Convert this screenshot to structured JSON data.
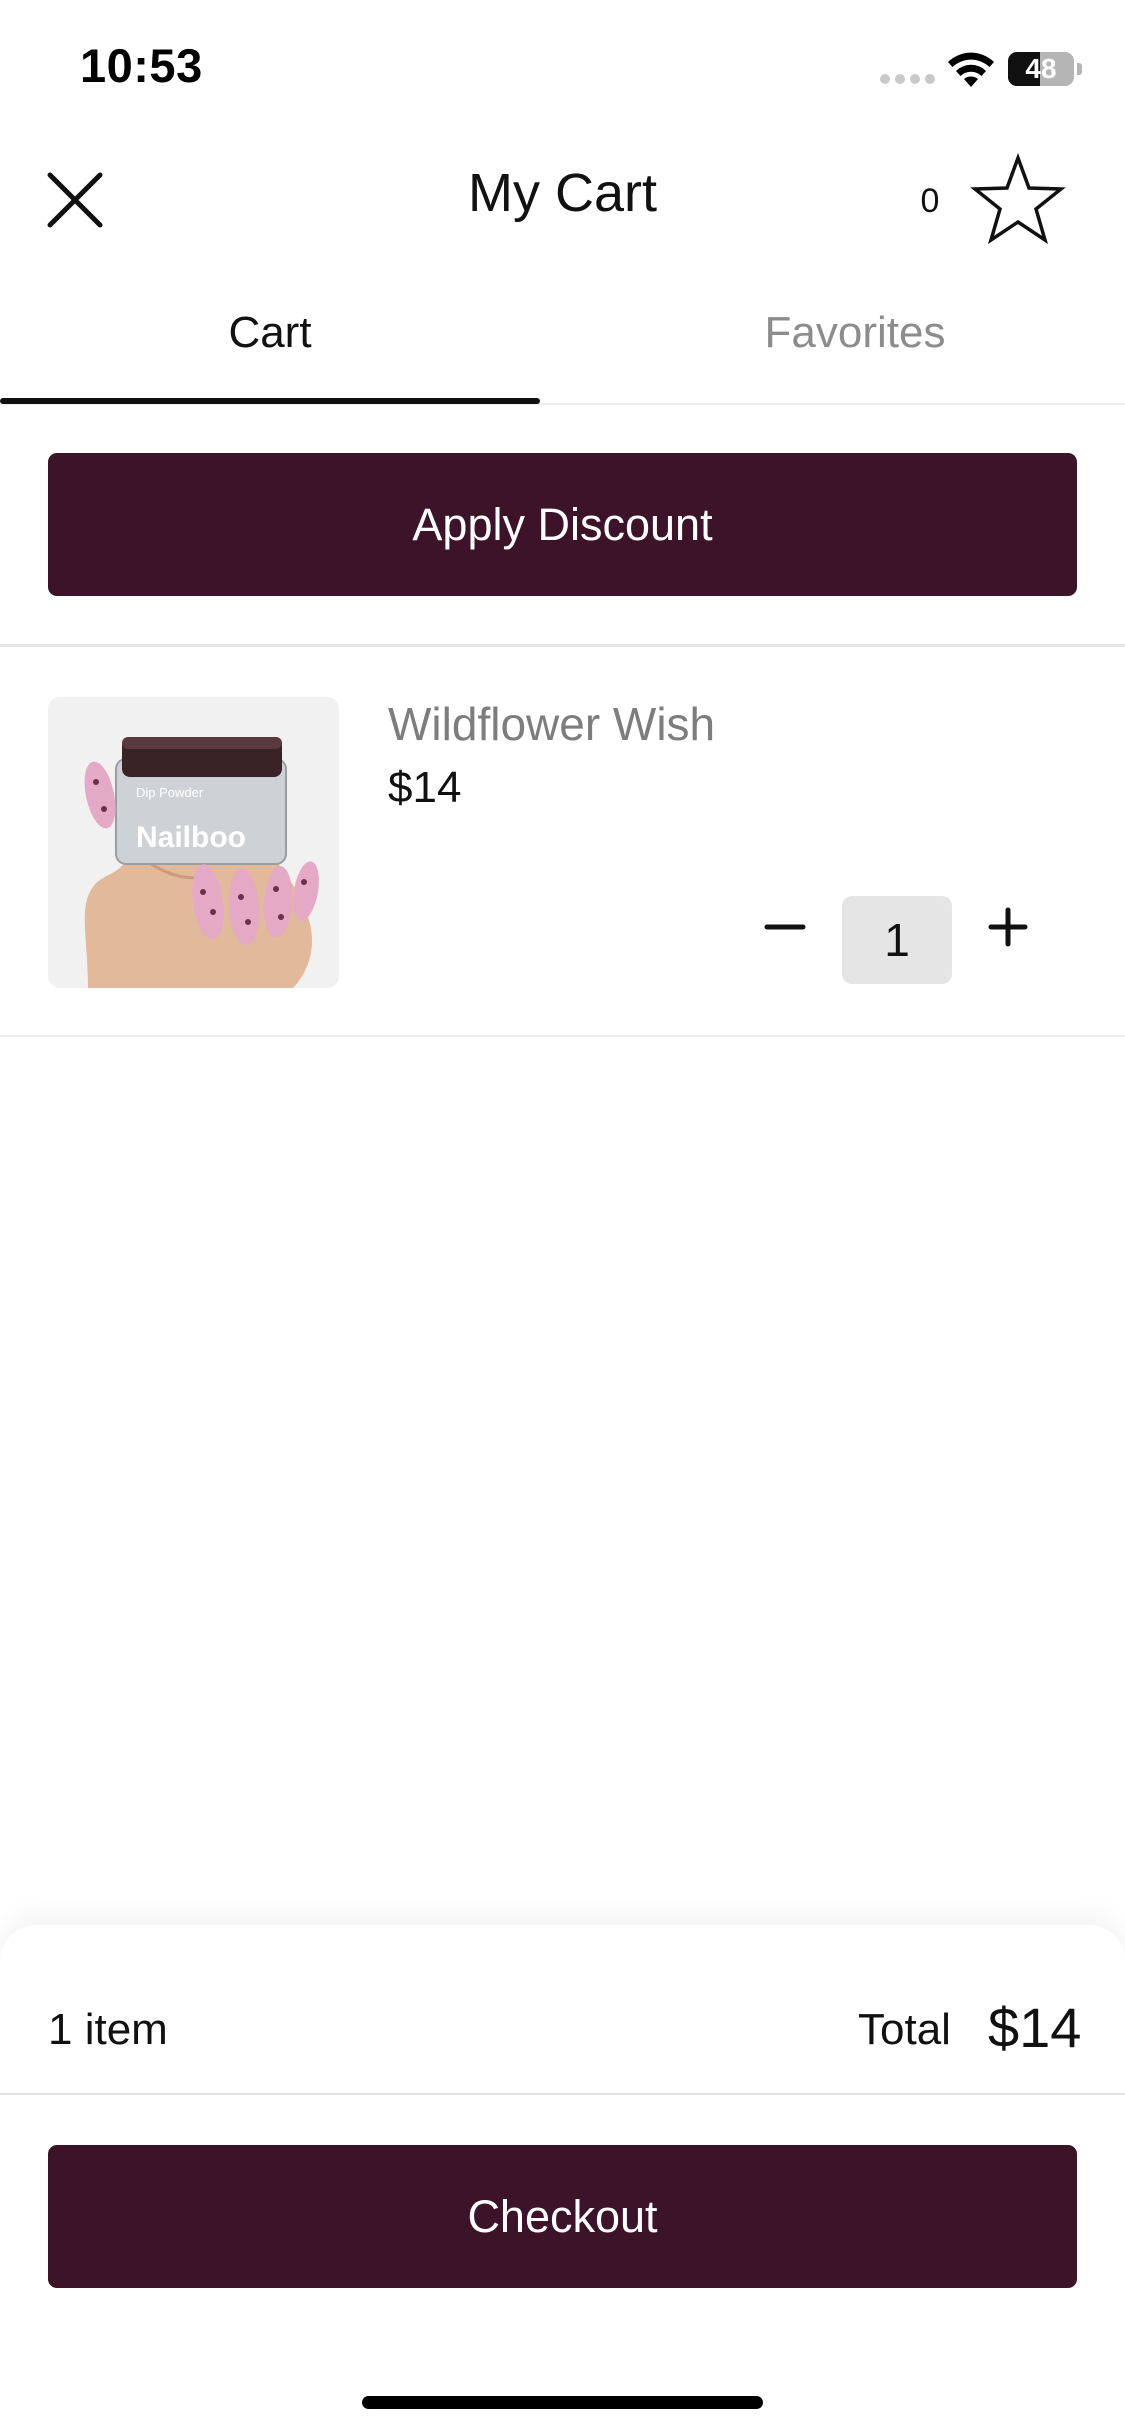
{
  "status_bar": {
    "time": "10:53",
    "battery_level": "48",
    "battery_fraction": 0.48,
    "icons": [
      "signal-icon",
      "wifi-icon",
      "battery-icon"
    ]
  },
  "header": {
    "title": "My Cart",
    "favorites_count": "0",
    "close_icon": "close-icon",
    "star_icon": "star-icon"
  },
  "tabs": [
    {
      "label": "Cart",
      "active": true
    },
    {
      "label": "Favorites",
      "active": false
    }
  ],
  "discount": {
    "label": "Apply Discount"
  },
  "cart": {
    "items": [
      {
        "name": "Wildflower Wish",
        "price": "$14",
        "quantity": "1",
        "image_text_brand": "Nailboo",
        "image_text_product": "Dip Powder"
      }
    ]
  },
  "summary": {
    "item_count": "1 item",
    "total_label": "Total",
    "total_value": "$14"
  },
  "checkout": {
    "label": "Checkout"
  },
  "colors": {
    "brand": "#3d1329",
    "muted_text": "#8c8c8c",
    "quantity_bg": "#e5e5e5"
  }
}
